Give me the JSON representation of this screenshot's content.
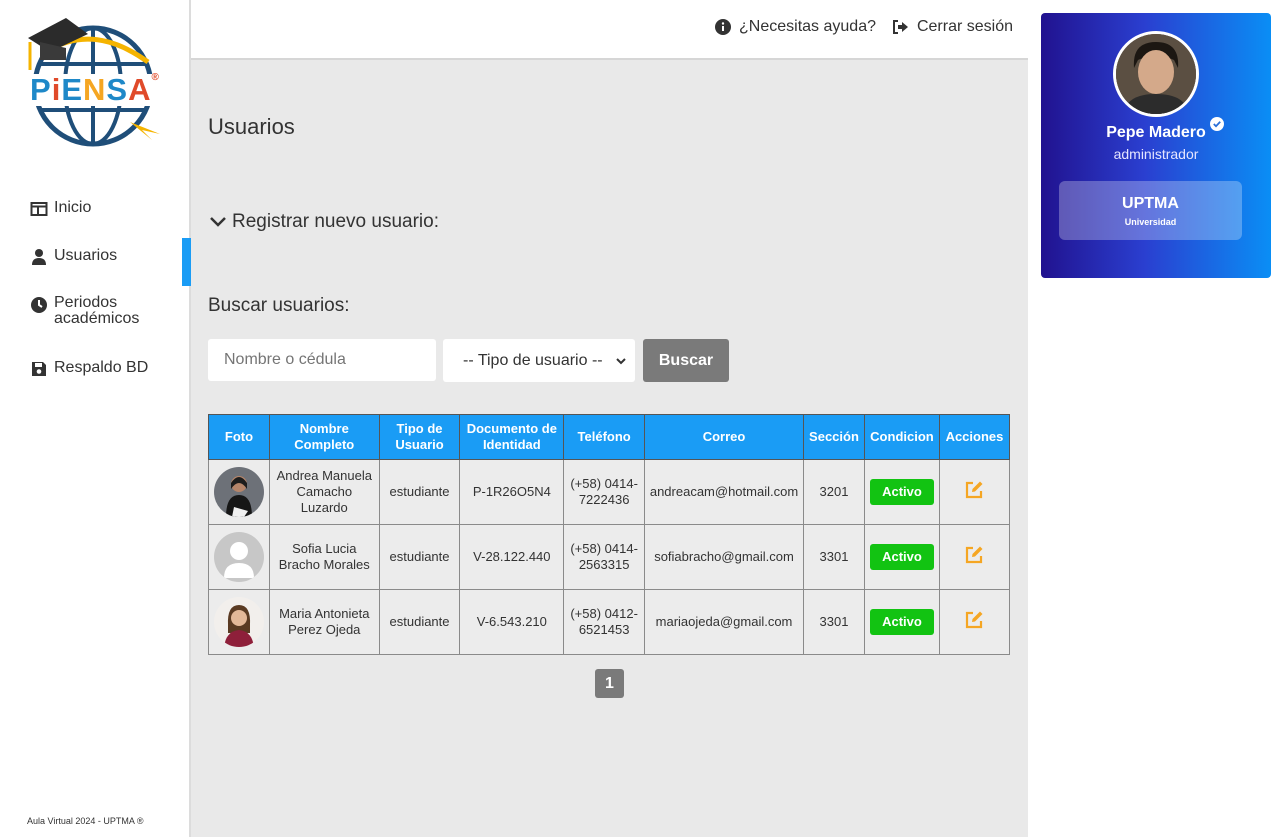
{
  "brand": {
    "logo_text": "PiENSA"
  },
  "sidebar": {
    "items": [
      {
        "label": "Inicio",
        "icon": "home-icon"
      },
      {
        "label": "Usuarios",
        "icon": "user-icon",
        "active": true
      },
      {
        "label": "Periodos académicos",
        "icon": "clock-icon"
      },
      {
        "label": "Respaldo BD",
        "icon": "floppy-disk-icon"
      }
    ],
    "footer": "Aula Virtual 2024 - UPTMA ®"
  },
  "topbar": {
    "help_label": "¿Necesitas ayuda?",
    "logout_label": "Cerrar sesión"
  },
  "main": {
    "title": "Usuarios",
    "register_label": "Registrar nuevo usuario:",
    "search_title": "Buscar usuarios:",
    "search_placeholder": "Nombre o cédula",
    "user_type_select": "-- Tipo de usuario --",
    "search_button": "Buscar",
    "table": {
      "headers": [
        "Foto",
        "Nombre Completo",
        "Tipo de Usuario",
        "Documento de Identidad",
        "Teléfono",
        "Correo",
        "Sección",
        "Condicion",
        "Acciones"
      ],
      "rows": [
        {
          "name": "Andrea Manuela Camacho Luzardo",
          "type": "estudiante",
          "doc": "P-1R26O5N4",
          "phone": "(+58) 0414-7222436",
          "email": "andreacam@hotmail.com",
          "section": "3201",
          "status": "Activo"
        },
        {
          "name": "Sofia Lucia Bracho Morales",
          "type": "estudiante",
          "doc": "V-28.122.440",
          "phone": "(+58) 0414-2563315",
          "email": "sofiabracho@gmail.com",
          "section": "3301",
          "status": "Activo"
        },
        {
          "name": "Maria Antonieta Perez Ojeda",
          "type": "estudiante",
          "doc": "V-6.543.210",
          "phone": "(+58) 0412-6521453",
          "email": "mariaojeda@gmail.com",
          "section": "3301",
          "status": "Activo"
        }
      ]
    },
    "pagination": {
      "current": "1"
    }
  },
  "profile": {
    "name": "Pepe Madero",
    "role": "administrador",
    "university": "UPTMA",
    "university_sub": "Universidad"
  },
  "colors": {
    "accent": "#1a9cf5",
    "status_active": "#12c312",
    "edit_icon": "#f5a623",
    "button_gray": "#7a7a7a"
  }
}
